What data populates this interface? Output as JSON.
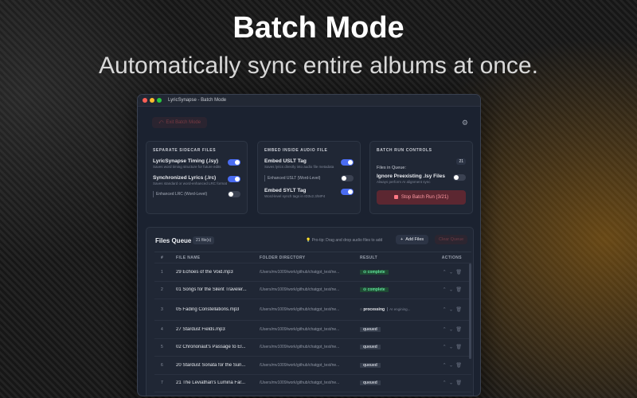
{
  "hero": {
    "title": "Batch Mode",
    "subtitle": "Automatically sync entire albums at once."
  },
  "window": {
    "title": "LyricSynapse - Batch Mode",
    "exit_label": "Exit Batch Mode"
  },
  "sidecar": {
    "heading": "SEPARATE SIDECAR FILES",
    "options": [
      {
        "title": "LyricSynapse Timing (.lsy)",
        "desc": "Saves word timing structure for future edits",
        "on": true
      },
      {
        "title": "Synchronized Lyrics (.lrc)",
        "desc": "Saves standard or word-enhanced LRC format",
        "on": true
      }
    ],
    "sub": {
      "label": "Enhanced LRC (Word-Level)",
      "on": false
    }
  },
  "embed": {
    "heading": "EMBED INSIDE AUDIO FILE",
    "uslt": {
      "title": "Embed USLT Tag",
      "desc": "Saves lyrics directly into audio file metadata",
      "on": true
    },
    "sub": {
      "label": "Enhanced USLT (Word-Level)",
      "on": false
    },
    "sylt": {
      "title": "Embed SYLT Tag",
      "desc": "Word-level synch tags in ID3v2.3/MP4",
      "on": true
    }
  },
  "controls": {
    "heading": "BATCH RUN CONTROLS",
    "files_label": "Files in Queue:",
    "files_count": "21",
    "ignore": {
      "title": "Ignore Preexisting .lsy Files",
      "desc": "Always perform AI alignment sync",
      "on": false
    },
    "stop_label": "Stop Batch Run (3/21)"
  },
  "queue": {
    "title": "Files Queue",
    "count": "21 file(s)",
    "tip": "Pro-tip: Drag and drop audio files to add",
    "add_label": "Add Files",
    "clear_label": "Clear Queue",
    "columns": [
      "#",
      "FILE NAME",
      "FOLDER DIRECTORY",
      "RESULT",
      "ACTIONS"
    ],
    "rows": [
      {
        "num": "1",
        "name": "29 Echoes of the Void.mp3",
        "dir": "/Users/mv1009/work/github/chatgpt_test/ne...",
        "status": "complete"
      },
      {
        "num": "2",
        "name": "01 Songs for the Silent Traveler...",
        "dir": "/Users/mv1009/work/github/chatgpt_test/ne...",
        "status": "complete"
      },
      {
        "num": "3",
        "name": "05 Fading Constellations.mp3",
        "dir": "/Users/mv1009/work/github/chatgpt_test/ne...",
        "status": "processing",
        "engine": "AI engining..."
      },
      {
        "num": "4",
        "name": "27 Stardust Fields.mp3",
        "dir": "/Users/mv1009/work/github/chatgpt_test/ne...",
        "status": "queued"
      },
      {
        "num": "5",
        "name": "02 Chrononaut's Passage to El...",
        "dir": "/Users/mv1009/work/github/chatgpt_test/ne...",
        "status": "queued"
      },
      {
        "num": "6",
        "name": "20 Stardust Sonata for the Sun...",
        "dir": "/Users/mv1009/work/github/chatgpt_test/ne...",
        "status": "queued"
      },
      {
        "num": "7",
        "name": "21 The Leviathan's Lumina Far...",
        "dir": "/Users/mv1009/work/github/chatgpt_test/ne...",
        "status": "queued"
      }
    ]
  }
}
